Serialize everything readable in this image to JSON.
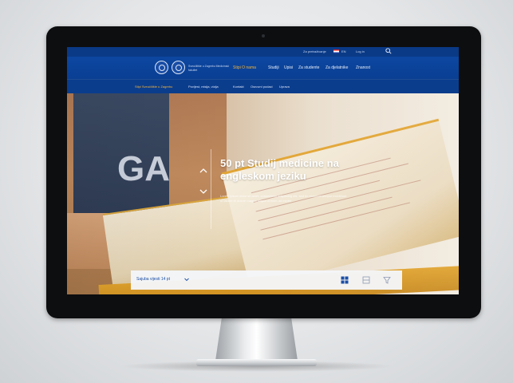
{
  "utility": {
    "links": [
      "Za pretraživanje",
      "EN",
      "Log in"
    ]
  },
  "header": {
    "org_name": "Sveučilište u Zagrebu Medicinski fakultet"
  },
  "nav": {
    "items": [
      "Stipi O nama",
      "Studiji",
      "Upisi",
      "Za studente",
      "Za djelatnike",
      "Znanost"
    ]
  },
  "subnav": {
    "items": [
      "Stipi Sveučilište u Zagrebu",
      "Povijest, misija, vizija",
      "Kontakt",
      "Osnovni podaci",
      "Uprava"
    ]
  },
  "hero": {
    "title": "50 pt Studij medicine na engleskom jeziku",
    "text": "Lorem ipsum dolor sit amet, consectetur adipiscing elit, sed do eiusmod tempor incididunt ut labore et dolore magna aliqua ut enim ad minim"
  },
  "filter_bar": {
    "label": "Sajuba vijesti 14 pt"
  },
  "icons": {
    "search": "search-icon",
    "grid": "grid-view-icon",
    "list": "list-view-icon",
    "filter": "filter-icon",
    "up": "chevron-up-icon",
    "down": "chevron-down-icon"
  },
  "colors": {
    "brand_blue": "#0c47a1",
    "accent_orange": "#f3b53b"
  }
}
